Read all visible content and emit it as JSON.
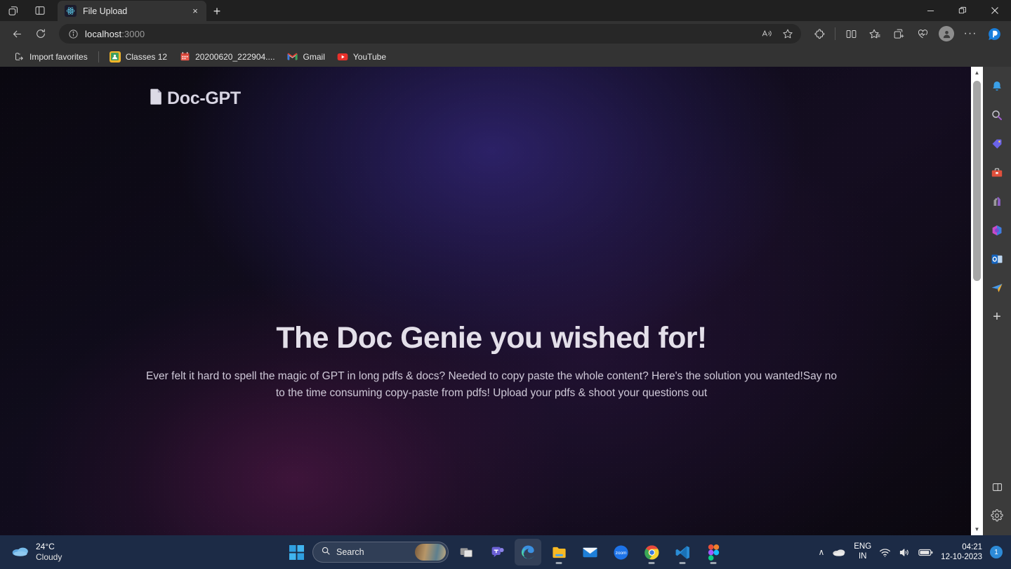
{
  "browser": {
    "tab": {
      "title": "File Upload",
      "favicon": "react-icon",
      "close": "×"
    },
    "newtab_label": "+",
    "window_controls": {
      "minimize": "–",
      "restore": "❐",
      "close": "✕"
    },
    "nav": {
      "back": "←",
      "refresh": "⟳"
    },
    "omnibox": {
      "host": "localhost",
      "port": ":3000",
      "info_icon": "info-icon"
    },
    "omnibox_actions": {
      "read_aloud": "read-aloud-icon",
      "favorite": "star-icon"
    },
    "toolbar": {
      "extensions": "extensions-icon",
      "split_screen": "split-screen-icon",
      "favorites": "favorites-icon",
      "collections": "collections-icon",
      "browser_essentials": "browser-essentials-icon",
      "profile": "profile-avatar",
      "settings_more": "···",
      "copilot": "copilot-icon"
    },
    "bookmarks": [
      {
        "label": "Import favorites",
        "icon": "import-favorites-icon"
      },
      {
        "label": "Classes 12",
        "icon": "classroom-icon"
      },
      {
        "label": "20200620_222904....",
        "icon": "calendar-icon"
      },
      {
        "label": "Gmail",
        "icon": "gmail-icon"
      },
      {
        "label": "YouTube",
        "icon": "youtube-icon"
      }
    ]
  },
  "sidebar": {
    "items": [
      {
        "name": "notifications",
        "icon": "bell-icon"
      },
      {
        "name": "search",
        "icon": "search-icon"
      },
      {
        "name": "shopping",
        "icon": "tag-icon"
      },
      {
        "name": "tools",
        "icon": "toolbox-icon"
      },
      {
        "name": "games",
        "icon": "games-icon"
      },
      {
        "name": "office",
        "icon": "office-icon"
      },
      {
        "name": "outlook",
        "icon": "outlook-icon"
      },
      {
        "name": "drop",
        "icon": "paper-plane-icon"
      }
    ],
    "add_label": "+",
    "customize": "panel-toggle-icon",
    "settings": "gear-icon"
  },
  "page": {
    "brand": {
      "name": "Doc-GPT",
      "icon": "document-icon"
    },
    "hero": {
      "title": "The Doc Genie you wished for!",
      "subtitle": "Ever felt it hard to spell the magic of GPT in long pdfs & docs? Needed to copy paste the whole content? Here's the solution you wanted!Say no to the time consuming copy-paste from pdfs! Upload your pdfs & shoot your questions out"
    },
    "colors": {
      "background_dark": "#0a0810",
      "glow_indigo": "#322678",
      "glow_magenta": "#781e5f",
      "title_text": "#e3dfe9",
      "body_text": "#cfc9d8"
    }
  },
  "scrollbar": {
    "up_arrow": "▲",
    "down_arrow": "▼"
  },
  "taskbar": {
    "weather": {
      "temperature": "24°C",
      "condition": "Cloudy",
      "icon": "cloud-icon"
    },
    "start_label": "start-icon",
    "search": {
      "placeholder": "Search",
      "icon": "search-icon",
      "thumbnail": "search-highlight-thumbnail"
    },
    "apps": [
      {
        "name": "task-view",
        "icon": "task-view-icon"
      },
      {
        "name": "teams",
        "icon": "teams-icon"
      },
      {
        "name": "edge",
        "icon": "edge-icon",
        "active": true
      },
      {
        "name": "file-explorer",
        "icon": "folder-icon"
      },
      {
        "name": "mail",
        "icon": "mail-icon"
      },
      {
        "name": "zoom",
        "icon": "zoom-icon",
        "label": "zoom"
      },
      {
        "name": "chrome",
        "icon": "chrome-icon"
      },
      {
        "name": "vs-code",
        "icon": "vscode-icon"
      },
      {
        "name": "figma",
        "icon": "figma-icon"
      }
    ],
    "tray": {
      "show_hidden": "∧",
      "cloud": "cloud-icon",
      "language_primary": "ENG",
      "language_secondary": "IN",
      "wifi": "wifi-icon",
      "volume": "volume-icon",
      "battery": "battery-icon",
      "time": "04:21",
      "date": "12-10-2023",
      "notification_count": "1"
    }
  }
}
